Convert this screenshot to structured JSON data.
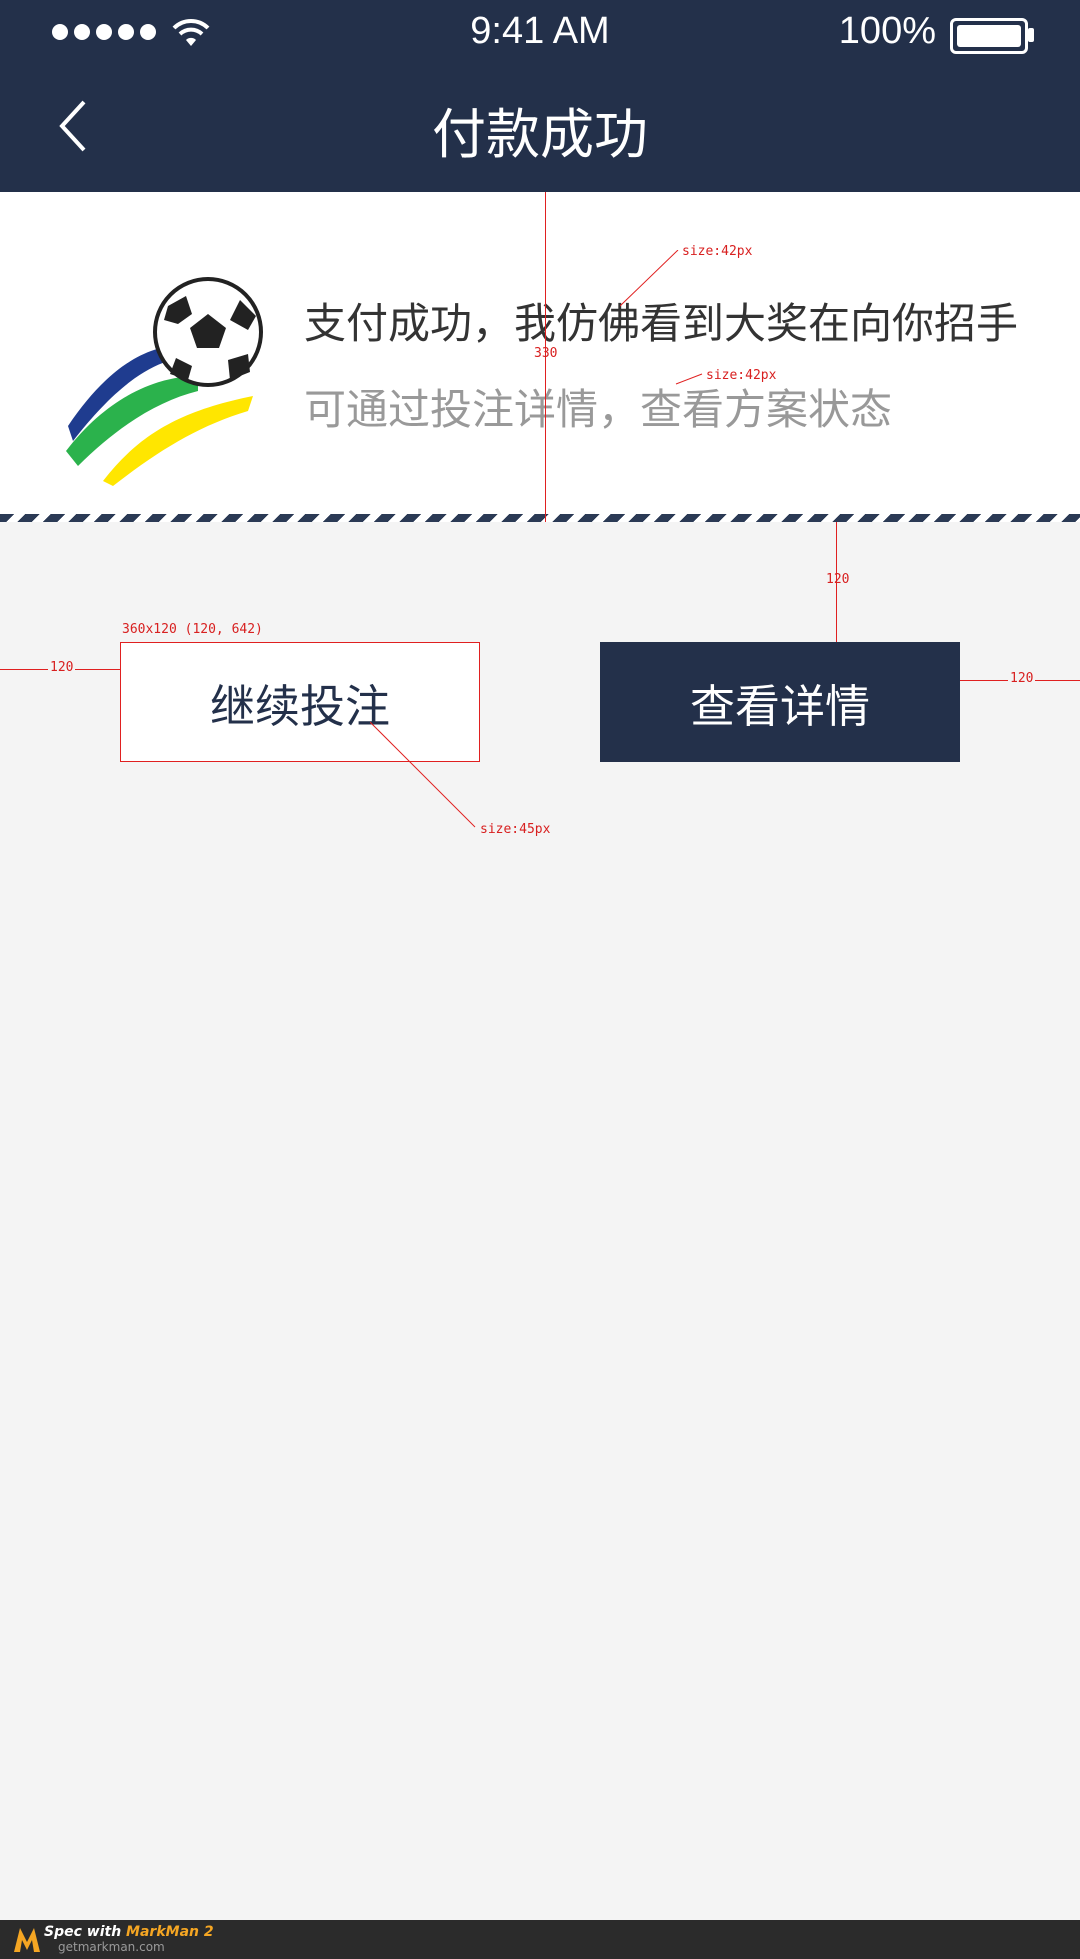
{
  "status_bar": {
    "time": "9:41 AM",
    "battery": "100%"
  },
  "nav": {
    "title": "付款成功"
  },
  "message": {
    "line1": "支付成功，我仿佛看到大奖在向你招手",
    "line2": "可通过投注详情，查看方案状态"
  },
  "buttons": {
    "continue": "继续投注",
    "details": "查看详情"
  },
  "annotations": {
    "size_line1": "size:42px",
    "size_line2": "size:42px",
    "height_330": "330",
    "gap_120_top": "120",
    "btn_dims": "360x120 (120, 642)",
    "left_margin": "120",
    "right_margin": "120",
    "btn_font_size": "size:45px"
  },
  "footer": {
    "brand_prefix": "Spec with ",
    "brand_name": "MarkMan 2",
    "url": "getmarkman.com"
  },
  "colors": {
    "header_bg": "#23304a",
    "accent_green": "#2bb24c",
    "accent_yellow": "#ffe600",
    "accent_blue": "#1f3c8f",
    "annotation_red": "#e02020"
  },
  "icons": [
    "back-chevron-icon",
    "wifi-icon",
    "battery-icon",
    "soccer-ball-icon"
  ]
}
